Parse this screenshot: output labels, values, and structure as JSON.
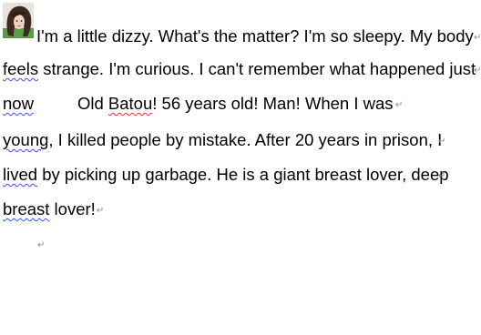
{
  "document": {
    "paragraph_mark": "↵",
    "lines": [
      {
        "text": "I'm a little dizzy. What's the matter? I'm so sleepy. My body"
      },
      {
        "word": "feels",
        "rest": " strange. I'm curious. I can't remember what happened just"
      },
      {
        "word": "now",
        "mid": "Old ",
        "name": "Batou",
        "rest": "! 56 years old! Man! When I was"
      },
      {
        "word": "young",
        "rest": ", I killed people by mistake. After 20 years in prison, I"
      },
      {
        "word": "lived",
        "rest": " by picking up garbage. He is a giant breast lover, deep"
      },
      {
        "word": "breast",
        "rest": " lover!"
      }
    ]
  }
}
